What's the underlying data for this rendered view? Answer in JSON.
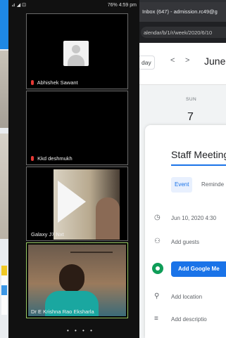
{
  "phone": {
    "status_left": "⊿ ◢ ⊡",
    "status_right": "76% 4:59 pm",
    "participants": [
      {
        "name": "Abhishek Sawant"
      },
      {
        "name": "Kkd deshmukh"
      },
      {
        "name": "Galaxy J7 Nxt"
      },
      {
        "name": "Dr E Krishna Rao Eksharla"
      }
    ],
    "pager": "• • • •"
  },
  "browser": {
    "tab_title": "Inbox (647) - admission.rc49@g",
    "url": "alendar/b/1/r/week/2020/6/10",
    "view_button": "day",
    "prev": "<",
    "next": ">",
    "month": "June",
    "day_name": "SUN",
    "day_number": "7"
  },
  "event": {
    "title": "Staff Meeting",
    "tab_event": "Event",
    "tab_reminder": "Reminde",
    "date_time": "Jun 10, 2020   4:30",
    "add_guests": "Add guests",
    "add_meet": "Add Google Me",
    "add_location": "Add location",
    "add_description": "Add descriptio"
  }
}
